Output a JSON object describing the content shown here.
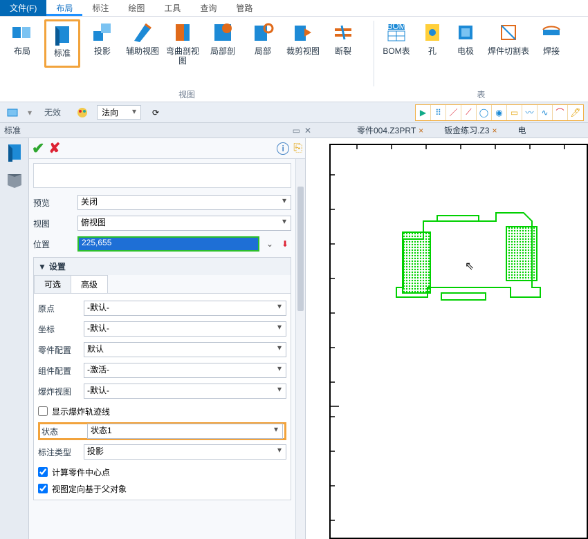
{
  "menubar": {
    "file": "文件(F)",
    "tabs": [
      "布局",
      "标注",
      "绘图",
      "工具",
      "查询",
      "管路"
    ],
    "activeIndex": 0
  },
  "ribbon": {
    "group_view_label": "视图",
    "group_table_label": "表",
    "items": [
      {
        "label": "布局"
      },
      {
        "label": "标准",
        "highlight": true
      },
      {
        "label": "投影"
      },
      {
        "label": "辅助视图"
      },
      {
        "label": "弯曲剖视图"
      },
      {
        "label": "局部剖"
      },
      {
        "label": "局部"
      },
      {
        "label": "裁剪视图"
      },
      {
        "label": "断裂"
      }
    ],
    "items2": [
      {
        "label": "BOM表"
      },
      {
        "label": "孔"
      },
      {
        "label": "电极"
      },
      {
        "label": "焊件切割表"
      },
      {
        "label": "焊接"
      }
    ]
  },
  "toolbar2": {
    "invalid": "无效",
    "normal": "法向"
  },
  "panel": {
    "title": "标准"
  },
  "doctabs": [
    {
      "label": "零件004.Z3PRT"
    },
    {
      "label": "钣金练习.Z3"
    },
    {
      "label": "电"
    }
  ],
  "form": {
    "preview_label": "预览",
    "preview_value": "关闭",
    "view_label": "视图",
    "view_value": "俯视图",
    "position_label": "位置",
    "position_value": "225,655",
    "settings_header": "设置",
    "tab_opt": "可选",
    "tab_adv": "高级",
    "origin_label": "原点",
    "origin_value": "-默认-",
    "coord_label": "坐标",
    "coord_value": "-默认-",
    "partcfg_label": "零件配置",
    "partcfg_value": "默认",
    "asmcfg_label": "组件配置",
    "asmcfg_value": "-激活-",
    "explode_label": "爆炸视图",
    "explode_value": "-默认-",
    "show_explode": "显示爆炸轨迹线",
    "state_label": "状态",
    "state_value": "状态1",
    "annot_label": "标注类型",
    "annot_value": "投影",
    "calc_center": "计算零件中心点",
    "view_orient": "视图定向基于父对象"
  }
}
